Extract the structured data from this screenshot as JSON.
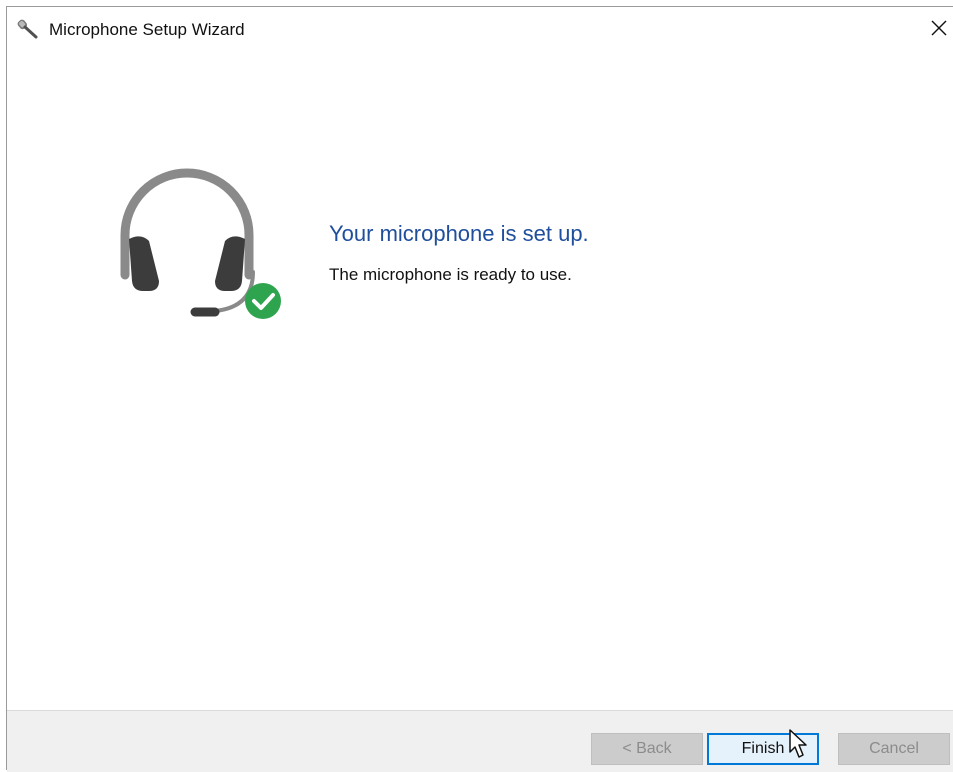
{
  "window": {
    "title": "Microphone Setup Wizard",
    "title_icon": "microphone-icon",
    "close_icon": "close-icon",
    "close_glyph": "✕"
  },
  "main": {
    "illustration": "headset-check-icon",
    "heading": "Your microphone is set up.",
    "message": "The microphone is ready to use."
  },
  "footer": {
    "back_label": "< Back",
    "finish_label": "Finish",
    "cancel_label": "Cancel"
  },
  "colors": {
    "heading": "#1f4e9c",
    "headset_band": "#8a8a8a",
    "earcup": "#3c3c3c",
    "check_badge": "#2ea44f",
    "focus_border": "#0078d7"
  }
}
